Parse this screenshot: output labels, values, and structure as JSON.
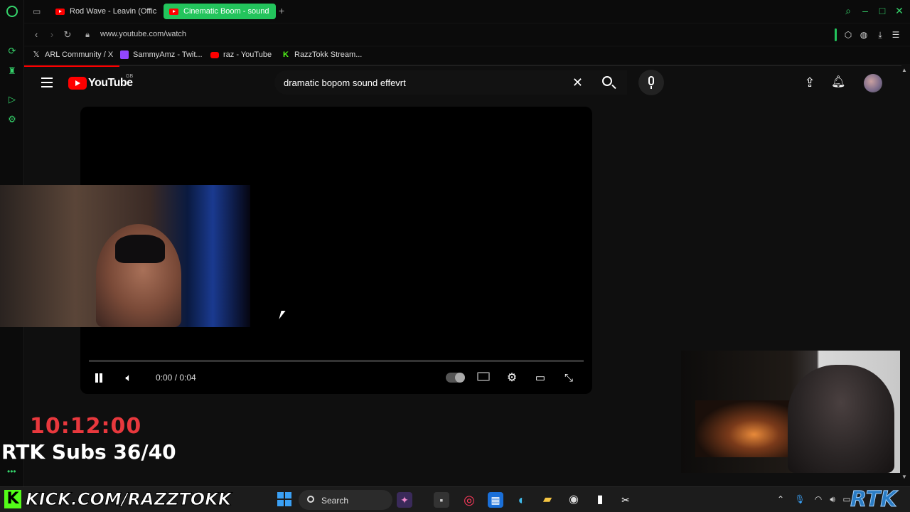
{
  "browser": {
    "tabs": [
      {
        "label": "Rod Wave - Leavin (Offici"
      },
      {
        "label": "Cinematic Boom - sound "
      }
    ],
    "url": "www.youtube.com/watch",
    "bookmarks": [
      {
        "label": "ARL Community / X",
        "icon": "x-logo-icon"
      },
      {
        "label": "SammyAmz - Twit...",
        "icon": "twitch-icon"
      },
      {
        "label": "raz - YouTube",
        "icon": "youtube-icon"
      },
      {
        "label": "RazzTokk Stream...",
        "icon": "kick-icon"
      }
    ]
  },
  "youtube": {
    "logo_text": "YouTube",
    "region": "GB",
    "search_query": "dramatic bopom sound effevrt"
  },
  "player": {
    "time": "0:00 / 0:04"
  },
  "overlay": {
    "timer": "10:12:00",
    "subs": "RTK Subs 36/40",
    "kick_url": "KICK.COM/RAZZTOKK",
    "kick_letter": "K",
    "badge": "RTK"
  },
  "taskbar": {
    "search_label": "Search"
  },
  "colors": {
    "accent_green": "#23c45c",
    "youtube_red": "#ff0000",
    "timer_red": "#e8383d",
    "kick_green": "#53fc18"
  }
}
